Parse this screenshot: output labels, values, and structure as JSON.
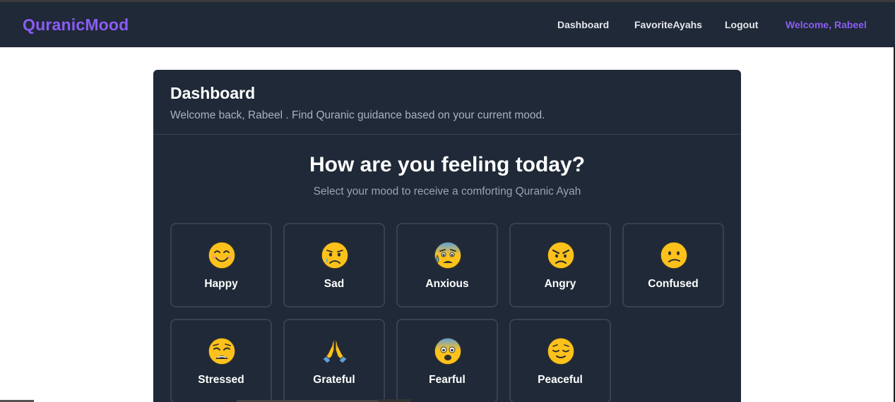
{
  "navbar": {
    "brand": "QuranicMood",
    "links": {
      "dashboard": "Dashboard",
      "favorites": "FavoriteAyahs",
      "logout": "Logout"
    },
    "welcome": "Welcome, Rabeel"
  },
  "card": {
    "title": "Dashboard",
    "subtitle": "Welcome back, Rabeel . Find Quranic guidance based on your current mood.",
    "question": "How are you feeling today?",
    "question_sub": "Select your mood to receive a comforting Quranic Ayah"
  },
  "moods": [
    {
      "label": "Happy",
      "icon": "smiling-face-icon"
    },
    {
      "label": "Sad",
      "icon": "crying-face-icon"
    },
    {
      "label": "Anxious",
      "icon": "anxious-sweat-face-icon"
    },
    {
      "label": "Angry",
      "icon": "angry-face-icon"
    },
    {
      "label": "Confused",
      "icon": "confused-face-icon"
    },
    {
      "label": "Stressed",
      "icon": "weary-face-icon"
    },
    {
      "label": "Grateful",
      "icon": "folded-hands-icon"
    },
    {
      "label": "Fearful",
      "icon": "fearful-face-icon"
    },
    {
      "label": "Peaceful",
      "icon": "relieved-face-icon"
    }
  ],
  "colors": {
    "accent": "#8b5cf6",
    "navbar_bg": "#1f2937",
    "card_bg": "#1f2937",
    "card_border": "#374151",
    "emoji_yellow": "#fcc21b"
  }
}
